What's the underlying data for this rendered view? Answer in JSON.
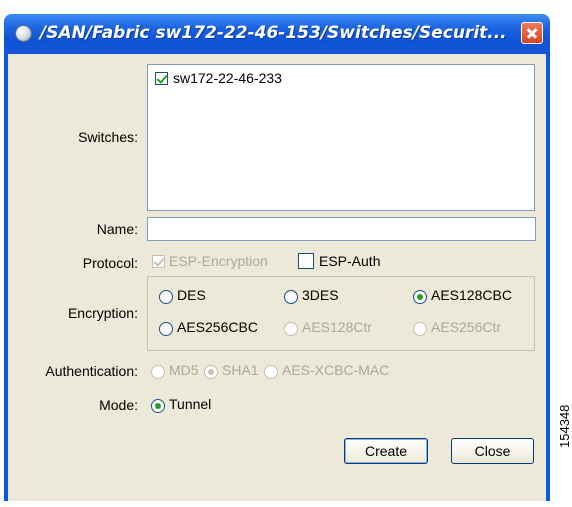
{
  "window": {
    "title": "/SAN/Fabric sw172-22-46-153/Switches/Securit..."
  },
  "form": {
    "switches_label": "Switches:",
    "switches": [
      {
        "name": "sw172-22-46-233",
        "checked": true
      }
    ],
    "name_label": "Name:",
    "name_value": "",
    "protocol_label": "Protocol:",
    "protocol_options": {
      "esp_encryption": {
        "label": "ESP-Encryption",
        "checked": true,
        "enabled": false
      },
      "esp_auth": {
        "label": "ESP-Auth",
        "checked": false,
        "enabled": true
      }
    },
    "encryption_label": "Encryption:",
    "encryption_options": {
      "des": {
        "label": "DES",
        "selected": false,
        "enabled": true
      },
      "3des": {
        "label": "3DES",
        "selected": false,
        "enabled": true
      },
      "aes128cbc": {
        "label": "AES128CBC",
        "selected": true,
        "enabled": true
      },
      "aes256cbc": {
        "label": "AES256CBC",
        "selected": false,
        "enabled": true
      },
      "aes128ctr": {
        "label": "AES128Ctr",
        "selected": false,
        "enabled": false
      },
      "aes256ctr": {
        "label": "AES256Ctr",
        "selected": false,
        "enabled": false
      }
    },
    "authentication_label": "Authentication:",
    "authentication_options": {
      "md5": {
        "label": "MD5",
        "selected": false,
        "enabled": false
      },
      "sha1": {
        "label": "SHA1",
        "selected": true,
        "enabled": false
      },
      "aes_xcbc_mac": {
        "label": "AES-XCBC-MAC",
        "selected": false,
        "enabled": false
      }
    },
    "mode_label": "Mode:",
    "mode_options": {
      "tunnel": {
        "label": "Tunnel",
        "selected": true,
        "enabled": true
      }
    }
  },
  "buttons": {
    "create": "Create",
    "close": "Close"
  },
  "figure_id": "154348",
  "colors": {
    "titlebar": "#0b58d8",
    "dialog_bg": "#ece9d8",
    "check_green": "#21a121",
    "disabled_text": "#aca899"
  }
}
